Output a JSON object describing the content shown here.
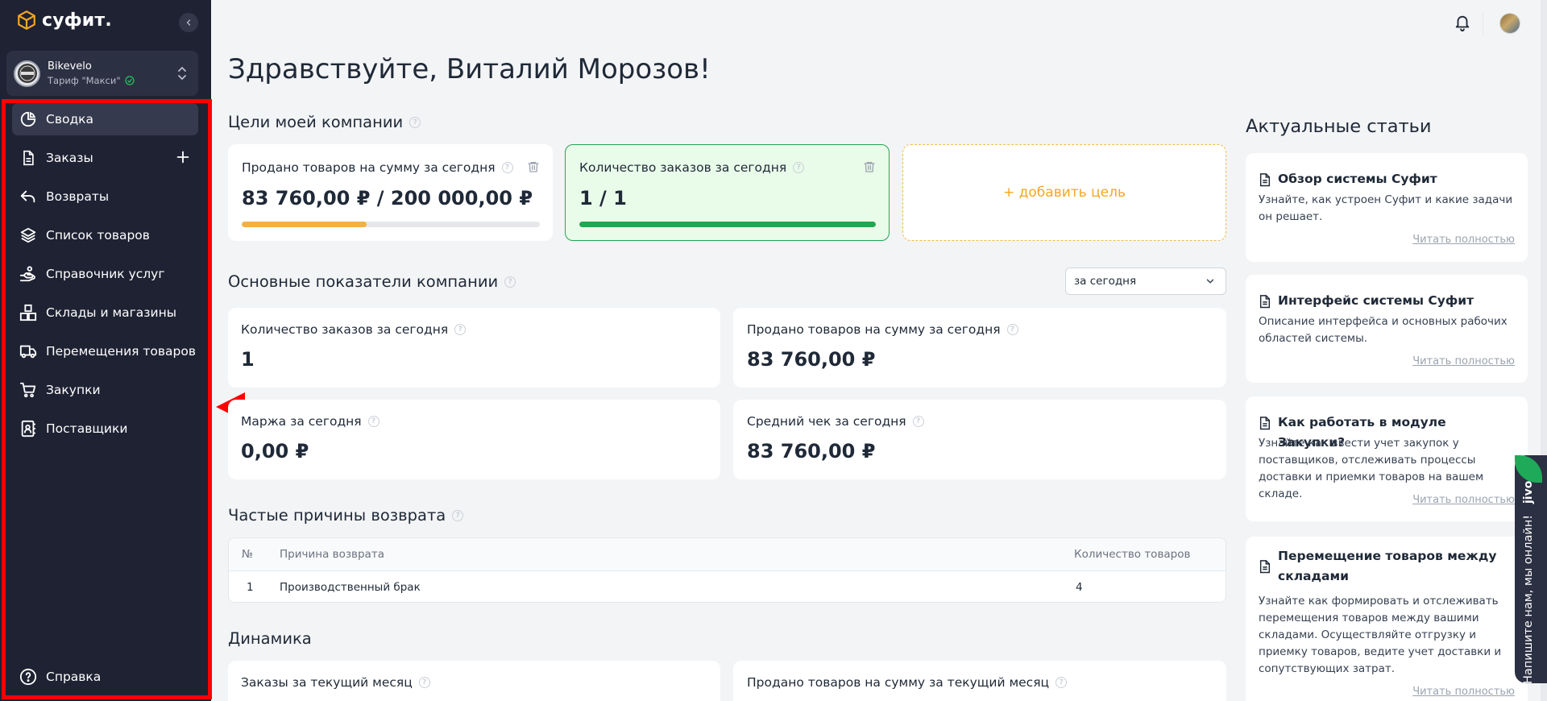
{
  "app": {
    "logo_text": "суфит."
  },
  "company": {
    "name": "Bikevelo",
    "plan": "Тариф \"Макси\""
  },
  "nav": {
    "items": [
      {
        "label": "Сводка"
      },
      {
        "label": "Заказы"
      },
      {
        "label": "Возвраты"
      },
      {
        "label": "Список товаров"
      },
      {
        "label": "Справочник услуг"
      },
      {
        "label": "Склады и магазины"
      },
      {
        "label": "Перемещения товаров"
      },
      {
        "label": "Закупки"
      },
      {
        "label": "Поставщики"
      }
    ],
    "help": "Справка"
  },
  "greeting": "Здравствуйте, Виталий Морозов!",
  "goals": {
    "title": "Цели моей компании",
    "cards": [
      {
        "label": "Продано товаров на сумму за сегодня",
        "value": "83 760,00 ₽ / 200 000,00 ₽",
        "progress": 0.42,
        "color": "#f5b042"
      },
      {
        "label": "Количество заказов за сегодня",
        "value": "1 / 1",
        "progress": 1.0,
        "color": "#22a652"
      }
    ],
    "add_label": "+ добавить цель"
  },
  "metrics": {
    "title": "Основные показатели компании",
    "period": "за сегодня",
    "cards": [
      {
        "label": "Количество заказов за сегодня",
        "value": "1"
      },
      {
        "label": "Продано товаров на сумму за сегодня",
        "value": "83 760,00 ₽"
      },
      {
        "label": "Маржа за сегодня",
        "value": "0,00 ₽"
      },
      {
        "label": "Средний чек за сегодня",
        "value": "83 760,00 ₽"
      }
    ]
  },
  "returns": {
    "title": "Частые причины возврата",
    "columns": [
      "№",
      "Причина возврата",
      "Количество товаров"
    ],
    "rows": [
      {
        "num": "1",
        "reason": "Производственный брак",
        "count": "4"
      }
    ]
  },
  "dynamics": {
    "title": "Динамика",
    "cards": [
      {
        "label": "Заказы за текущий месяц"
      },
      {
        "label": "Продано товаров на сумму за текущий месяц"
      }
    ]
  },
  "articles": {
    "title": "Актуальные статьи",
    "read_more": "Читать полностью",
    "items": [
      {
        "title": "Обзор системы Суфит",
        "desc": "Узнайте, как устроен Суфит и какие задачи он решает."
      },
      {
        "title": "Интерфейс системы Суфит",
        "desc": "Описание интерфейса и основных рабочих областей системы."
      },
      {
        "title": "Как работать в модуле Закупки?",
        "desc": "Узнайте как ввести учет закупок у поставщиков, отслеживать процессы доставки и приемки товаров на вашем складе."
      },
      {
        "title": "Перемещение товаров между складами",
        "desc": "Узнайте как формировать и отслеживать перемещения товаров между вашими складами. Осуществляйте отгрузку и приемку товаров, ведите учет доставки и сопутствующих затрат."
      }
    ]
  },
  "chat_widget": {
    "text": "Напишите нам, мы онлайн!",
    "brand": "jivo"
  },
  "colors": {
    "sidebar": "#1f2233",
    "accent": "#f5a623",
    "success": "#22a652",
    "highlight": "#ff0000"
  }
}
